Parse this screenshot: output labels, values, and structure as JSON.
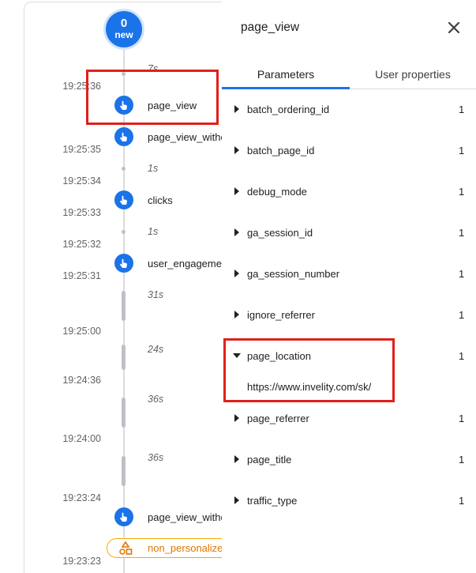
{
  "timeline": {
    "count_bubble": {
      "count": "0",
      "label": "new"
    },
    "timestamps": [
      "19:25:36",
      "19:25:35",
      "19:25:34",
      "19:25:33",
      "19:25:32",
      "19:25:31",
      "19:25:00",
      "19:24:36",
      "19:24:00",
      "19:23:24",
      "19:23:23"
    ],
    "gaps": [
      "7s",
      "1s",
      "1s",
      "31s",
      "24s",
      "36s",
      "36s"
    ],
    "events": [
      "page_view",
      "page_view_witho",
      "clicks",
      "user_engageme",
      "page_view_witho"
    ],
    "consent_event": "non_personalize"
  },
  "panel": {
    "title": "page_view",
    "tabs": [
      "Parameters",
      "User properties"
    ],
    "params": [
      {
        "name": "batch_ordering_id",
        "count": "1"
      },
      {
        "name": "batch_page_id",
        "count": "1"
      },
      {
        "name": "debug_mode",
        "count": "1"
      },
      {
        "name": "ga_session_id",
        "count": "1"
      },
      {
        "name": "ga_session_number",
        "count": "1"
      },
      {
        "name": "ignore_referrer",
        "count": "1"
      },
      {
        "name": "page_location",
        "count": "1"
      },
      {
        "name": "page_referrer",
        "count": "1"
      },
      {
        "name": "page_title",
        "count": "1"
      },
      {
        "name": "traffic_type",
        "count": "1"
      }
    ],
    "expanded_value": "https://www.invelity.com/sk/"
  },
  "colors": {
    "accent": "#1a73e8",
    "highlight": "#e0201b",
    "warning": "#f9ab00"
  }
}
